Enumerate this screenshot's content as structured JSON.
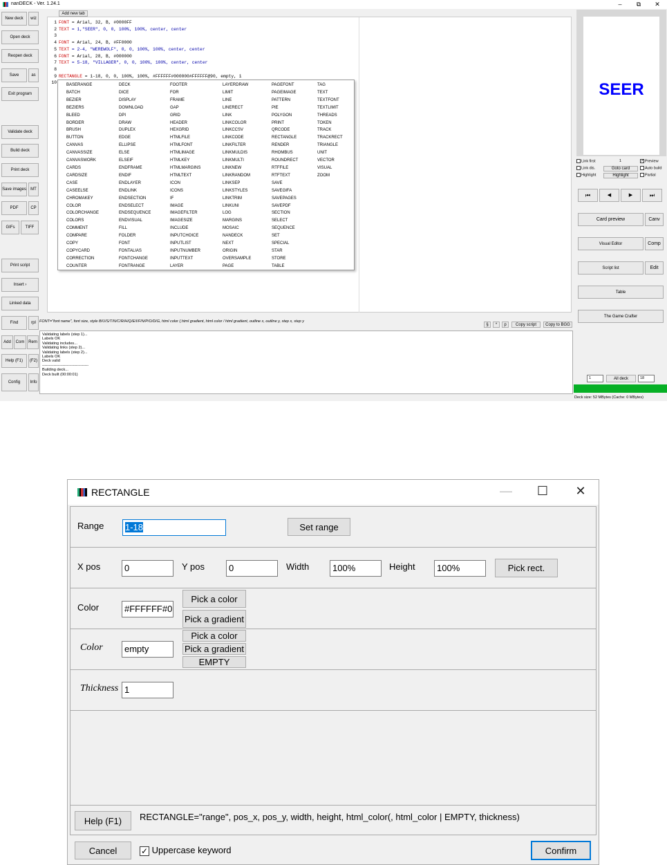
{
  "app": {
    "title": "nanDECK - Ver. 1.24.1",
    "min": "–",
    "max": "⧉",
    "close": "✕"
  },
  "left_buttons": {
    "new_deck": "New deck",
    "wiz": "wiz",
    "open_deck": "Open deck",
    "reopen_deck": "Reopen deck",
    "save": "Save",
    "as": "as",
    "exit": "Exit program",
    "validate": "Validate deck",
    "build": "Build deck",
    "print": "Print deck",
    "save_images": "Save images",
    "mt": "MT",
    "pdf": "PDF",
    "cp": "CP",
    "gifs": "GIFs",
    "tiff": "TIFF",
    "print_script": "Print script",
    "insert": "Insert ›",
    "linked_data": "Linked data",
    "find": "Find",
    "rpl": "rpl",
    "add": "Add",
    "com": "Com",
    "rem": "Rem",
    "help": "Help (F1)",
    "f2": "(F2)",
    "config": "Config",
    "info": "Info"
  },
  "editor": {
    "add_tab": "Add new tab",
    "lines": [
      {
        "n": "1",
        "k": "FONT",
        "r": " = Arial, 32, B, #0000FF",
        "t": "kw"
      },
      {
        "n": "2",
        "k": "TEXT",
        "r": " = 1,\"SEER\", 0, 0, 100%, 100%, center, center",
        "t": "kw"
      },
      {
        "n": "3",
        "k": "",
        "r": "",
        "t": ""
      },
      {
        "n": "4",
        "k": "FONT",
        "r": " = Arial, 24, B, #FF0000",
        "t": "kw"
      },
      {
        "n": "5",
        "k": "TEXT",
        "r": " = 2-4, \"WEREWOLF\", 0, 0, 100%, 100%, center, center",
        "t": "kw"
      },
      {
        "n": "6",
        "k": "FONT",
        "r": " = Arial, 28, B, #000000",
        "t": "kw"
      },
      {
        "n": "7",
        "k": "TEXT",
        "r": " = 5-18, \"VILLAGER\", 0, 0, 100%, 100%, center, center",
        "t": "kw"
      },
      {
        "n": "8",
        "k": "",
        "r": "",
        "t": ""
      },
      {
        "n": "9",
        "k": "RECTANGLE",
        "r": " = 1-18, 0, 0, 100%, 100%, #FFFFFF#000000#FFFFFF@90, empty, 1",
        "t": "kw"
      },
      {
        "n": "10",
        "k": "",
        "r": "",
        "t": ""
      }
    ]
  },
  "autocomplete": {
    "col1": [
      "BASERANGE",
      "BATCH",
      "BEZIER",
      "BEZIERS",
      "BLEED",
      "BORDER",
      "BRUSH",
      "BUTTON",
      "CANVAS",
      "CANVASSIZE",
      "CANVASWORK",
      "CARDS",
      "CARDSIZE",
      "CASE",
      "CASEELSE",
      "CHROMAKEY",
      "COLOR",
      "COLORCHANGE",
      "COLORS",
      "COMMENT",
      "COMPARE",
      "COPY",
      "COPYCARD",
      "CORRECTION",
      "COUNTER"
    ],
    "col2": [
      "DECK",
      "DICE",
      "DISPLAY",
      "DOWNLOAD",
      "DPI",
      "DRAW",
      "DUPLEX",
      "EDGE",
      "ELLIPSE",
      "ELSE",
      "ELSEIF",
      "ENDFRAME",
      "ENDIF",
      "ENDLAYER",
      "ENDLINK",
      "ENDSECTION",
      "ENDSELECT",
      "ENDSEQUENCE",
      "ENDVISUAL",
      "FILL",
      "FOLDER",
      "FONT",
      "FONTALIAS",
      "FONTCHANGE",
      "FONTRANGE"
    ],
    "col3": [
      "FOOTER",
      "FOR",
      "FRAME",
      "GAP",
      "GRID",
      "HEADER",
      "HEXGRID",
      "HTMLFILE",
      "HTMLFONT",
      "HTMLIMAGE",
      "HTMLKEY",
      "HTMLMARGINS",
      "HTMLTEXT",
      "ICON",
      "ICONS",
      "IF",
      "IMAGE",
      "IMAGEFILTER",
      "IMAGESIZE",
      "INCLUDE",
      "INPUTCHOICE",
      "INPUTLIST",
      "INPUTNUMBER",
      "INPUTTEXT",
      "LAYER"
    ],
    "col4": [
      "LAYERDRAW",
      "LIMIT",
      "LINE",
      "LINERECT",
      "LINK",
      "LINKCOLOR",
      "LINKCCSV",
      "LINKCODE",
      "LINKFILTER",
      "LINKMULDIS",
      "LINKMULTI",
      "LINKNEW",
      "LINKRANDOM",
      "LINKSEP",
      "LINKSTYLES",
      "LINKTRIM",
      "LINKUNI",
      "LOG",
      "MARGINS",
      "MOSAIC",
      "NANDECK",
      "NEXT",
      "ORIGIN",
      "OVERSAMPLE",
      "PAGE"
    ],
    "col5": [
      "PAGEFONT",
      "PAGEIMAGE",
      "PATTERN",
      "PIE",
      "POLYGON",
      "PRINT",
      "QRCODE",
      "RECTANGLE",
      "RENDER",
      "RHOMBUS",
      "ROUNDRECT",
      "RTFFILE",
      "RTFTEXT",
      "SAVE",
      "SAVEGIFA",
      "SAVEPAGES",
      "SAVEPDF",
      "SECTION",
      "SELECT",
      "SEQUENCE",
      "SET",
      "SPECIAL",
      "STAR",
      "STORE",
      "TABLE"
    ],
    "col6": [
      "TAG",
      "TEXT",
      "TEXTFONT",
      "TEXTLIMIT",
      "THREADS",
      "TOKEN",
      "TRACK",
      "TRACKRECT",
      "TRIANGLE",
      "UNIT",
      "VECTOR",
      "VISUAL",
      "ZOOM"
    ]
  },
  "hint": "FONT=\"font name\", font size, style B/U/S/T/N/C/R/H/Q/E/I/F/N/P/O/D/G, html color (,html gradient, html color / html gradient, outline x, outline y, step x, step y",
  "tools": {
    "s": "§",
    "star": "*",
    "p": "p",
    "copy_script": "Copy script",
    "copy_bgg": "Copy to BGG"
  },
  "log": "Validating labels (step 1)...\nLabels OK\nValidating includes...\nValidating links (step 2)...\nValidating labels (step 2)...\nLabels OK\nDeck valid\n------------------------------------\nBuilding deck...\nDeck built (00:00:01)",
  "preview": {
    "card_text": "SEER",
    "link_first": "Link first",
    "link_first_val": "1",
    "preview": "Preview",
    "link_dis": "Link dis.",
    "goto_card": "Goto card",
    "auto_build": "Auto build",
    "highlight": "Highlight",
    "highlight_btn": "Highlight",
    "partial": "Partial"
  },
  "nav": {
    "first": "⏮",
    "prev": "◀",
    "next": "▶",
    "last": "⏭"
  },
  "right_buttons": {
    "card_preview": "Card preview",
    "canv": "Canv",
    "visual_editor": "Visual Editor",
    "comp": "Comp",
    "script_list": "Script list",
    "edit": "Edit",
    "table": "Table",
    "game_crafter": "The Game Crafter",
    "from": "1",
    "all_deck": "All deck",
    "to": "18"
  },
  "status": "Deck size: 52 MBytes (Cache: 0 MBytes)",
  "dialog": {
    "title": "RECTANGLE",
    "min": "—",
    "max": "☐",
    "close": "✕",
    "range_label": "Range",
    "range_value": "1-18",
    "set_range": "Set range",
    "xpos_label": "X pos",
    "xpos": "0",
    "ypos_label": "Y pos",
    "ypos": "0",
    "width_label": "Width",
    "width": "100%",
    "height_label": "Height",
    "height": "100%",
    "pick_rect": "Pick rect.",
    "color_label": "Color",
    "color_value": "#FFFFFF#0",
    "pick_color": "Pick a color",
    "pick_gradient": "Pick a gradient",
    "color2_label": "Color",
    "color2_value": "empty",
    "pick_color2": "Pick a color",
    "pick_gradient2": "Pick a gradient",
    "empty_btn": "EMPTY",
    "thickness_label": "Thickness",
    "thickness": "1",
    "help": "Help (F1)",
    "syntax": "RECTANGLE=\"range\", pos_x, pos_y, width, height, html_color(, html_color | EMPTY, thickness)",
    "cancel": "Cancel",
    "uppercase": "Uppercase keyword",
    "uppercase_check": "✓",
    "confirm": "Confirm"
  }
}
